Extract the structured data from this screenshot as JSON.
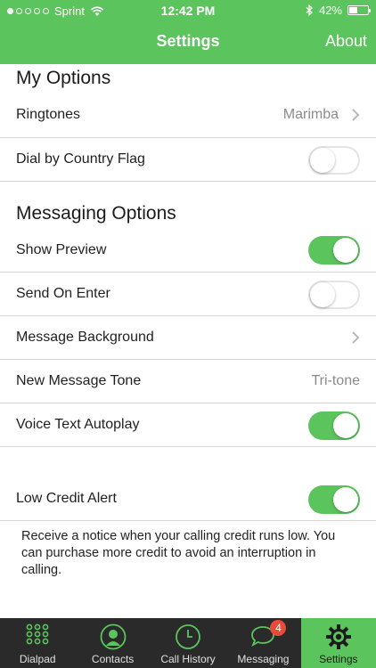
{
  "status_bar": {
    "carrier": "Sprint",
    "time": "12:42 PM",
    "battery_percent": "42%",
    "battery_level": 0.42,
    "signal_bars": 1
  },
  "nav": {
    "title": "Settings",
    "about_label": "About"
  },
  "my_options": {
    "title": "My Options",
    "ringtones_label": "Ringtones",
    "ringtones_value": "Marimba",
    "dial_flag_label": "Dial by Country Flag",
    "dial_flag_on": false
  },
  "messaging_options": {
    "title": "Messaging Options",
    "show_preview_label": "Show Preview",
    "show_preview_on": true,
    "send_on_enter_label": "Send On Enter",
    "send_on_enter_on": false,
    "message_background_label": "Message Background",
    "new_message_tone_label": "New Message Tone",
    "new_message_tone_value": "Tri-tone",
    "voice_text_autoplay_label": "Voice Text Autoplay",
    "voice_text_autoplay_on": true
  },
  "credit": {
    "low_credit_label": "Low Credit Alert",
    "low_credit_on": true,
    "note": "Receive a notice when your calling credit runs low. You can purchase more credit to avoid an interruption in calling."
  },
  "tabs": [
    {
      "label": "Dialpad",
      "icon": "dialpad-icon"
    },
    {
      "label": "Contacts",
      "icon": "contact-icon"
    },
    {
      "label": "Call History",
      "icon": "clock-icon"
    },
    {
      "label": "Messaging",
      "icon": "chat-bubble-icon",
      "badge": "4"
    },
    {
      "label": "Settings",
      "icon": "gear-icon",
      "active": true
    }
  ],
  "colors": {
    "accent": "#5cc45d",
    "tabbar": "#2a2a2a",
    "badge": "#e74b3c"
  }
}
